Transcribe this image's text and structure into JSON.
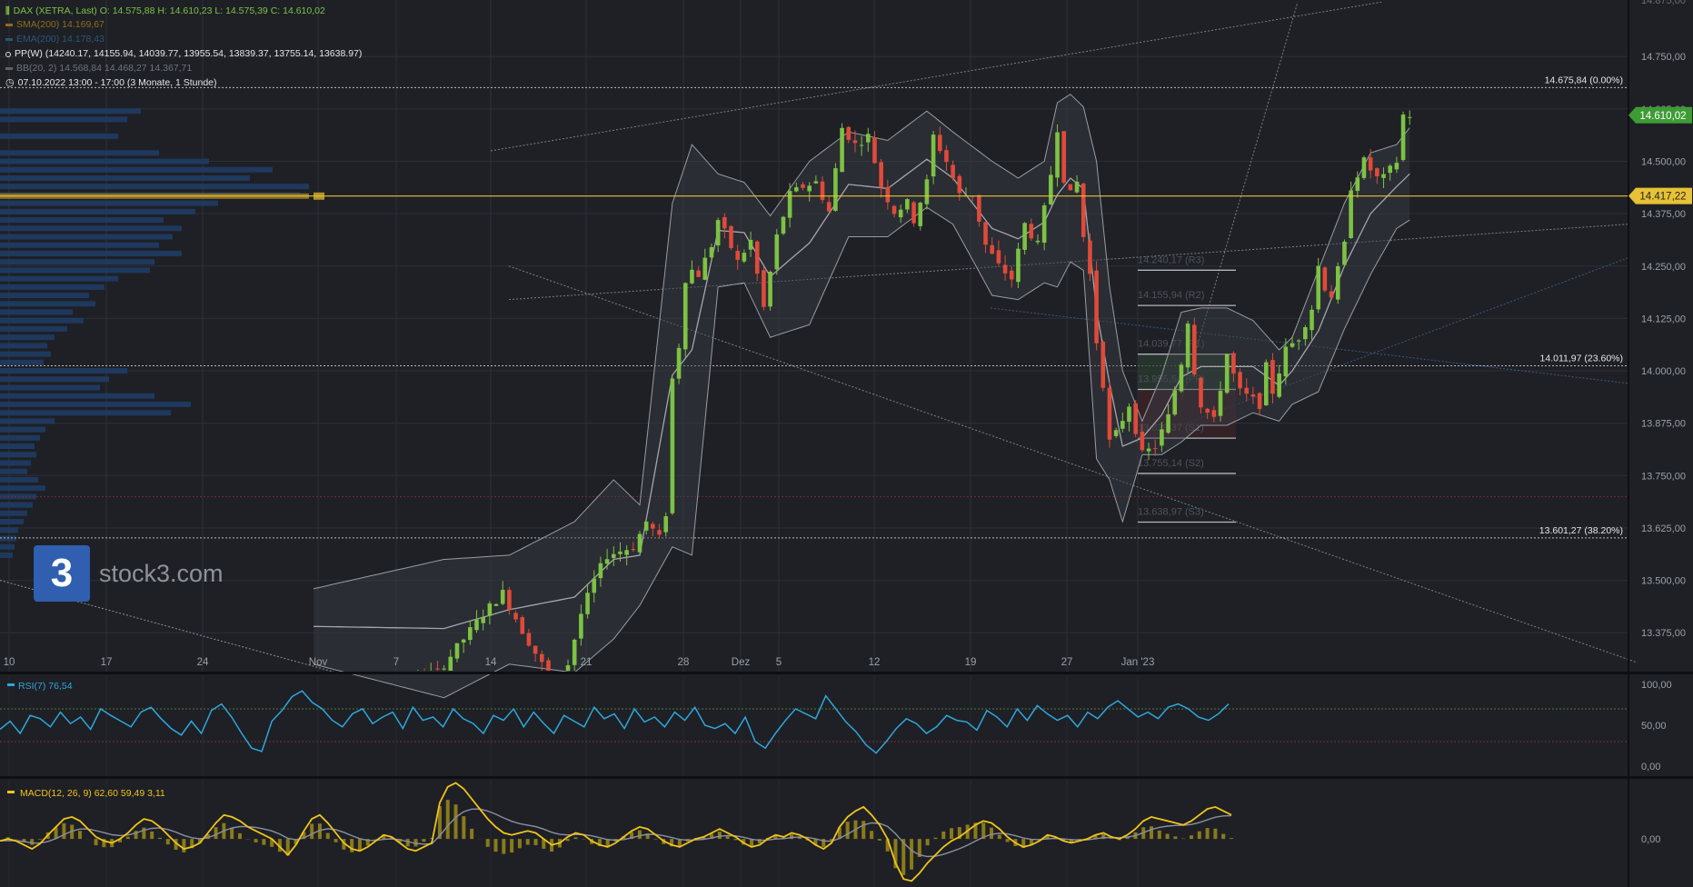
{
  "header": {
    "ohlc": "DAX (XETRA, Last)  O: 14.575,88  H: 14.610,23  L: 14.575,39  C: 14.610,02",
    "sma": "SMA(200)  14.169,67",
    "ema": "EMA(200)  14.178,43",
    "pp": "PP(W)  (14240.17, 14155.94, 14039.77, 13955.54, 13839.37, 13755.14, 13638.97)",
    "bb": "BB(20, 2)  14.568,84  14.468,27  14.367,71",
    "date": "07.10.2022 13:00 - 17:00   (3 Monate, 1 Stunde)"
  },
  "colors": {
    "background": "#1e2026",
    "grid": "#2c2f36",
    "up": "#7dc243",
    "down": "#e04a3a",
    "price_tag": "#3e9c35",
    "line_tag": "#e7c235",
    "rsi": "#2fa6d9",
    "macd": "#f0c419",
    "signal": "#8b8fa0",
    "bb": "#9a9ca3"
  },
  "watermark": {
    "logo": "3",
    "text": "stock3.com"
  },
  "chart_data": [
    {
      "type": "candlestick",
      "title": "DAX (XETRA, Last)",
      "ylim": [
        13280,
        14885
      ],
      "y_ticks": [
        "14.750,00",
        "14.625,00",
        "14.500,00",
        "14.375,00",
        "14.250,00",
        "14.125,00",
        "14.000,00",
        "13.875,00",
        "13.750,00",
        "13.625,00",
        "13.500,00",
        "13.375,00"
      ],
      "y_tick_values": [
        14750,
        14625,
        14500,
        14375,
        14250,
        14125,
        14000,
        13875,
        13750,
        13625,
        13500,
        13375
      ],
      "x_ticks": [
        "10",
        "17",
        "24",
        "Nov",
        "7",
        "14",
        "21",
        "28",
        "Dez",
        "5",
        "12",
        "19",
        "27",
        "Jan '23"
      ],
      "last_price": {
        "value": 14610.02,
        "label": "14.610,02"
      },
      "horizontal_line": {
        "value": 14417.22,
        "label": "14.417,22"
      },
      "fib_levels": [
        {
          "value": 14675.84,
          "label": "14.675,84 (0.00%)"
        },
        {
          "value": 14011.97,
          "label": "14.011,97 (23.60%)"
        },
        {
          "value": 13601.27,
          "label": "13.601,27 (38.20%)"
        }
      ],
      "pivots": [
        {
          "value": 14240.17,
          "label": "14.240,17 (R3)"
        },
        {
          "value": 14155.94,
          "label": "14.155,94 (R2)"
        },
        {
          "value": 14039.77,
          "label": "14.039,77 (R1)"
        },
        {
          "value": 13955.54,
          "label": "13.955,54 (PP)"
        },
        {
          "value": 13839.37,
          "label": "13.839,37 (S1)"
        },
        {
          "value": 13755.14,
          "label": "13.755,14 (S2)"
        },
        {
          "value": 13638.97,
          "label": "13.638,97 (S3)"
        }
      ],
      "price_path": [
        [
          0,
          13200
        ],
        [
          20,
          13280
        ],
        [
          27,
          13420
        ],
        [
          30,
          13470
        ],
        [
          33,
          13380
        ],
        [
          36,
          13300
        ],
        [
          38,
          13260
        ],
        [
          40,
          13300
        ],
        [
          42,
          13420
        ],
        [
          44,
          13500
        ],
        [
          46,
          13560
        ],
        [
          48,
          13570
        ],
        [
          50,
          13580
        ],
        [
          52,
          13640
        ],
        [
          54,
          13600
        ],
        [
          55,
          13660
        ],
        [
          56,
          13980
        ],
        [
          57,
          14060
        ],
        [
          58,
          14220
        ],
        [
          59,
          14240
        ],
        [
          60,
          14230
        ],
        [
          62,
          14300
        ],
        [
          63,
          14360
        ],
        [
          64,
          14330
        ],
        [
          66,
          14260
        ],
        [
          68,
          14310
        ],
        [
          70,
          14150
        ],
        [
          72,
          14320
        ],
        [
          74,
          14420
        ],
        [
          76,
          14440
        ],
        [
          78,
          14450
        ],
        [
          80,
          14380
        ],
        [
          82,
          14580
        ],
        [
          84,
          14540
        ],
        [
          86,
          14560
        ],
        [
          88,
          14440
        ],
        [
          90,
          14380
        ],
        [
          92,
          14400
        ],
        [
          93,
          14360
        ],
        [
          95,
          14450
        ],
        [
          96,
          14560
        ],
        [
          98,
          14500
        ],
        [
          100,
          14420
        ],
        [
          102,
          14420
        ],
        [
          104,
          14300
        ],
        [
          106,
          14250
        ],
        [
          108,
          14220
        ],
        [
          110,
          14350
        ],
        [
          112,
          14300
        ],
        [
          114,
          14470
        ],
        [
          115,
          14580
        ],
        [
          116,
          14460
        ],
        [
          117,
          14420
        ],
        [
          118,
          14450
        ],
        [
          119,
          14320
        ],
        [
          120,
          14230
        ],
        [
          121,
          14070
        ],
        [
          122,
          13970
        ],
        [
          123,
          13830
        ],
        [
          124,
          13850
        ],
        [
          126,
          13920
        ],
        [
          128,
          13800
        ],
        [
          130,
          13820
        ],
        [
          132,
          13890
        ],
        [
          134,
          14020
        ],
        [
          135,
          14120
        ],
        [
          136,
          14000
        ],
        [
          137,
          13920
        ],
        [
          138,
          13900
        ],
        [
          139,
          13880
        ],
        [
          140,
          13960
        ],
        [
          141,
          14040
        ],
        [
          142,
          13990
        ],
        [
          143,
          13950
        ],
        [
          144,
          13940
        ],
        [
          146,
          13920
        ],
        [
          147,
          14010
        ],
        [
          148,
          13950
        ],
        [
          150,
          14050
        ],
        [
          152,
          14080
        ],
        [
          154,
          14150
        ],
        [
          155,
          14250
        ],
        [
          156,
          14200
        ],
        [
          157,
          14180
        ],
        [
          159,
          14300
        ],
        [
          160,
          14440
        ],
        [
          162,
          14500
        ],
        [
          164,
          14460
        ],
        [
          165,
          14460
        ],
        [
          167,
          14500
        ],
        [
          168,
          14610
        ]
      ],
      "bb_path": [
        [
          0,
          13480,
          13300
        ],
        [
          20,
          13550,
          13220
        ],
        [
          30,
          13560,
          13300
        ],
        [
          40,
          13640,
          13280
        ],
        [
          46,
          13740,
          13360
        ],
        [
          50,
          13680,
          13440
        ],
        [
          55,
          14400,
          13580
        ],
        [
          58,
          14540,
          13560
        ],
        [
          62,
          14470,
          14200
        ],
        [
          66,
          14450,
          14210
        ],
        [
          70,
          14370,
          14080
        ],
        [
          76,
          14500,
          14110
        ],
        [
          82,
          14570,
          14320
        ],
        [
          88,
          14550,
          14320
        ],
        [
          94,
          14620,
          14390
        ],
        [
          98,
          14570,
          14350
        ],
        [
          104,
          14500,
          14180
        ],
        [
          108,
          14460,
          14170
        ],
        [
          112,
          14500,
          14210
        ],
        [
          114,
          14640,
          14200
        ],
        [
          116,
          14660,
          14260
        ],
        [
          118,
          14630,
          14240
        ],
        [
          120,
          14500,
          13790
        ],
        [
          122,
          14200,
          13740
        ],
        [
          124,
          14000,
          13640
        ],
        [
          127,
          13880,
          13800
        ],
        [
          130,
          13990,
          13800
        ],
        [
          133,
          14140,
          13830
        ],
        [
          136,
          14150,
          13870
        ],
        [
          140,
          14150,
          13870
        ],
        [
          144,
          14120,
          13900
        ],
        [
          148,
          14050,
          13880
        ],
        [
          150,
          14080,
          13920
        ],
        [
          154,
          14240,
          13950
        ],
        [
          158,
          14400,
          14100
        ],
        [
          162,
          14520,
          14230
        ],
        [
          166,
          14540,
          14340
        ],
        [
          168,
          14580,
          14360
        ]
      ],
      "total_bars": 169
    },
    {
      "type": "line",
      "title": "RSI(7)  76,54",
      "ylim": [
        -10,
        110
      ],
      "y_ticks": [
        "100,00",
        "50,00",
        "0,00"
      ],
      "y_tick_values": [
        100,
        50,
        0
      ],
      "levels": [
        70,
        30
      ],
      "values": [
        45,
        55,
        40,
        62,
        58,
        48,
        66,
        52,
        60,
        45,
        70,
        62,
        55,
        48,
        66,
        72,
        58,
        46,
        38,
        55,
        40,
        68,
        76,
        60,
        40,
        22,
        18,
        55,
        68,
        85,
        92,
        78,
        70,
        56,
        48,
        64,
        70,
        52,
        60,
        66,
        46,
        72,
        56,
        60,
        48,
        70,
        58,
        52,
        40,
        62,
        56,
        70,
        48,
        66,
        52,
        40,
        62,
        55,
        48,
        72,
        58,
        64,
        46,
        70,
        54,
        60,
        48,
        66,
        56,
        72,
        50,
        46,
        52,
        40,
        60,
        30,
        22,
        40,
        56,
        70,
        64,
        58,
        86,
        70,
        54,
        42,
        26,
        16,
        30,
        46,
        58,
        52,
        40,
        48,
        62,
        56,
        54,
        44,
        68,
        60,
        48,
        70,
        56,
        74,
        64,
        56,
        62,
        48,
        66,
        58,
        72,
        80,
        70,
        60,
        66,
        58,
        72,
        76,
        70,
        60,
        56,
        64,
        76
      ]
    },
    {
      "type": "line",
      "title": "MACD(12, 26, 9)  62,60  59,49  3,11",
      "ylim": [
        -120,
        150
      ],
      "y_ticks": [
        "0,00"
      ],
      "y_tick_values": [
        0
      ],
      "values": [
        -5,
        0,
        -5,
        -15,
        -25,
        -12,
        10,
        30,
        50,
        55,
        45,
        25,
        5,
        -5,
        -10,
        0,
        15,
        35,
        50,
        45,
        30,
        10,
        -10,
        -25,
        -20,
        -10,
        15,
        40,
        60,
        55,
        45,
        30,
        20,
        10,
        0,
        -20,
        -40,
        -15,
        20,
        50,
        60,
        40,
        15,
        -10,
        -25,
        -30,
        -20,
        -5,
        10,
        5,
        -10,
        -25,
        -30,
        -20,
        -10,
        90,
        130,
        140,
        125,
        100,
        75,
        50,
        30,
        15,
        10,
        15,
        20,
        15,
        0,
        -15,
        -10,
        5,
        15,
        10,
        -5,
        -15,
        -20,
        -10,
        5,
        20,
        30,
        25,
        10,
        -5,
        -15,
        -20,
        -10,
        0,
        5,
        15,
        25,
        15,
        5,
        -10,
        -20,
        -15,
        0,
        10,
        5,
        15,
        10,
        0,
        -15,
        -25,
        -10,
        30,
        55,
        70,
        80,
        60,
        35,
        0,
        -60,
        -100,
        -105,
        -85,
        -60,
        -40,
        -20,
        -5,
        5,
        20,
        35,
        45,
        40,
        25,
        5,
        -10,
        -20,
        -15,
        -5,
        10,
        5,
        -5,
        -10,
        -5,
        0,
        10,
        15,
        5,
        0,
        10,
        25,
        45,
        55,
        50,
        45,
        40,
        35,
        45,
        60,
        75,
        80,
        70,
        60
      ]
    }
  ]
}
